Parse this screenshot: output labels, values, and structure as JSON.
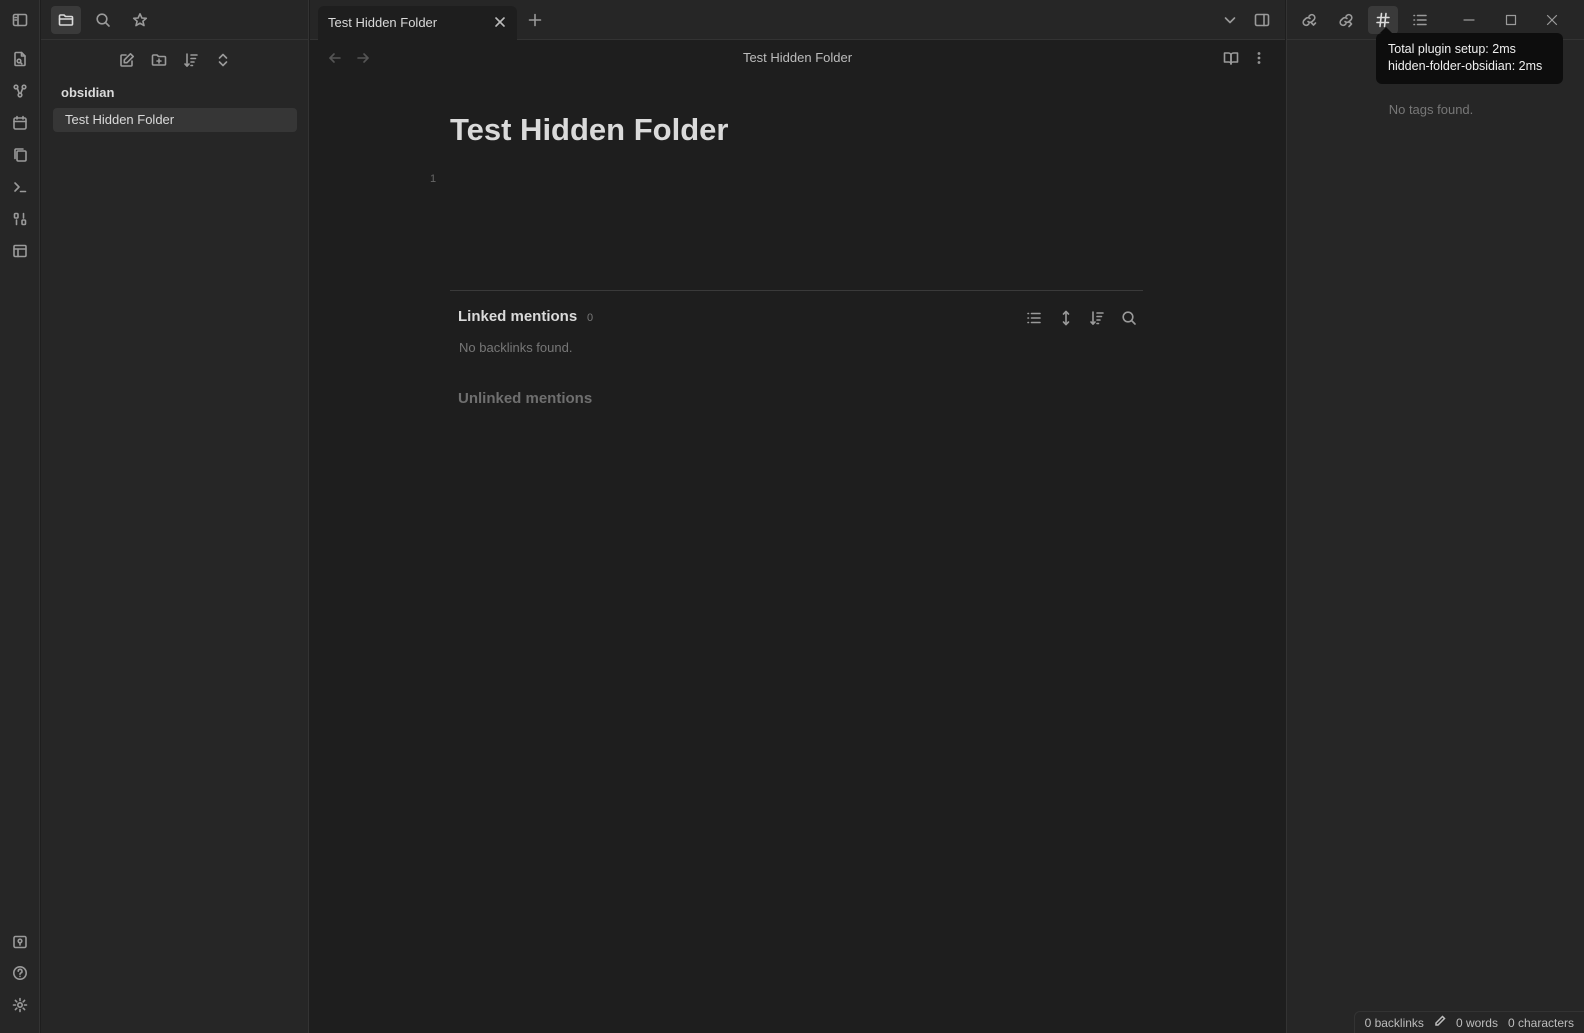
{
  "ribbon": {
    "top_icons": [
      "files-icon",
      "graph-icon",
      "calendar-icon",
      "copy-icon",
      "terminal-icon",
      "binary-icon",
      "layout-icon"
    ],
    "bottom_icons": [
      "vault-switch-icon",
      "help-icon",
      "settings-icon"
    ]
  },
  "left_sidebar": {
    "vault_name": "obsidian",
    "files": [
      {
        "name": "Test Hidden Folder"
      }
    ]
  },
  "tabs": [
    {
      "label": "Test Hidden Folder"
    }
  ],
  "editor": {
    "nav_title": "Test Hidden Folder",
    "note_title": "Test Hidden Folder",
    "line_number": "1",
    "linked_mentions_label": "Linked mentions",
    "linked_mentions_count": "0",
    "no_backlinks_text": "No backlinks found.",
    "unlinked_mentions_label": "Unlinked mentions"
  },
  "right_sidebar": {
    "no_tags_text": "No tags found."
  },
  "tooltip": {
    "line1": "Total plugin setup: 2ms",
    "line2": "hidden-folder-obsidian: 2ms"
  },
  "status_bar": {
    "backlinks": "0 backlinks",
    "words": "0 words",
    "characters": "0 characters"
  }
}
